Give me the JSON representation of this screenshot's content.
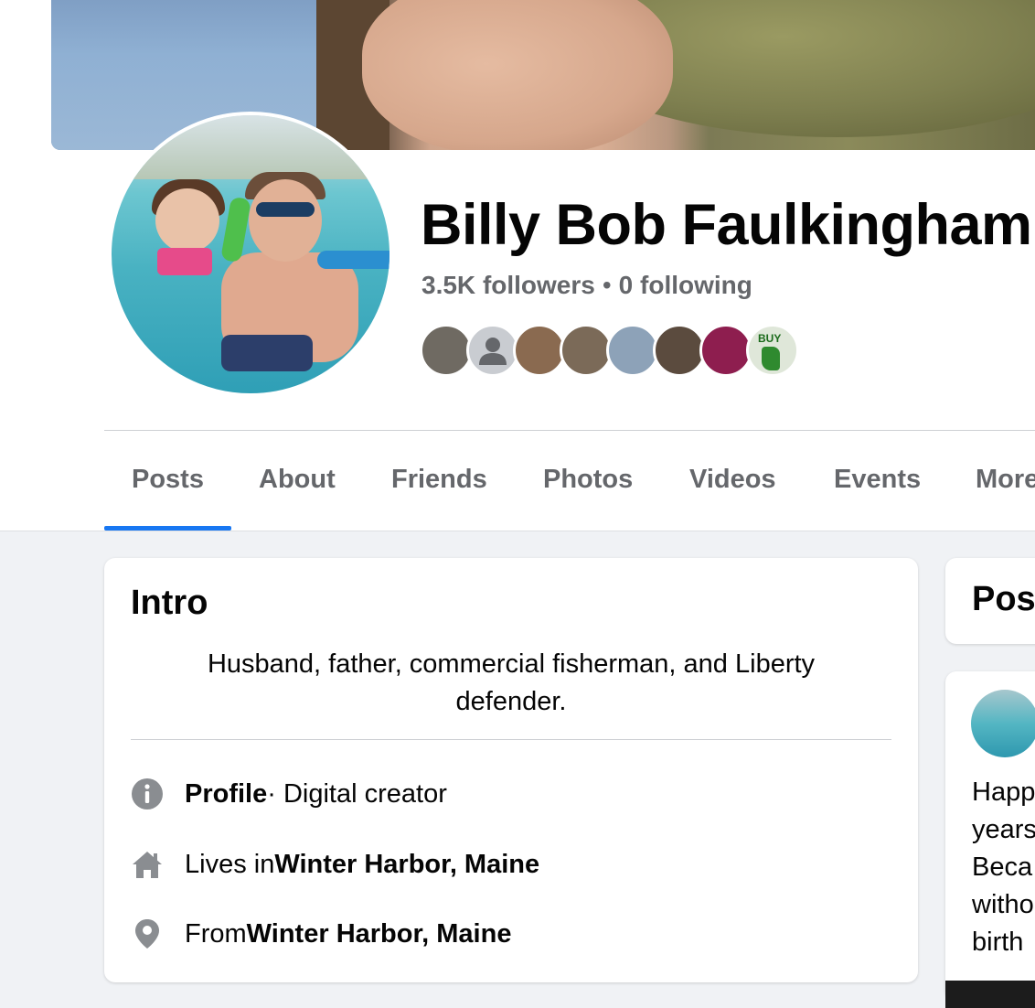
{
  "profile": {
    "name": "Billy Bob Faulkingham",
    "followers_count": "3.5K",
    "followers_label": "followers",
    "separator": "•",
    "following_count": "0",
    "following_label": "following"
  },
  "friends_preview": [
    {
      "name": "friend-1",
      "color": "#6f6a62"
    },
    {
      "name": "friend-2",
      "color": "#c9ccd1"
    },
    {
      "name": "friend-3",
      "color": "#8a6a50"
    },
    {
      "name": "friend-4",
      "color": "#7b6a58"
    },
    {
      "name": "friend-5",
      "color": "#8da2b8"
    },
    {
      "name": "friend-6",
      "color": "#5b4b3e"
    },
    {
      "name": "friend-7",
      "color": "#8e1e4f"
    },
    {
      "name": "friend-8",
      "color": "#dfe7d9"
    }
  ],
  "friend_badge_text": "BUY",
  "tabs": [
    {
      "label": "Posts",
      "active": true
    },
    {
      "label": "About",
      "active": false
    },
    {
      "label": "Friends",
      "active": false
    },
    {
      "label": "Photos",
      "active": false
    },
    {
      "label": "Videos",
      "active": false
    },
    {
      "label": "Events",
      "active": false
    },
    {
      "label": "More",
      "active": false
    }
  ],
  "intro": {
    "title": "Intro",
    "bio": "Husband, father, commercial fisherman, and Liberty defender.",
    "details": [
      {
        "icon": "info-icon",
        "bold_prefix": "Profile",
        "text": " · Digital creator",
        "bold_suffix": ""
      },
      {
        "icon": "home-icon",
        "bold_prefix": "",
        "text": "Lives in ",
        "bold_suffix": "Winter Harbor, Maine"
      },
      {
        "icon": "location-pin-icon",
        "bold_prefix": "",
        "text": "From ",
        "bold_suffix": "Winter Harbor, Maine"
      }
    ]
  },
  "posts_section": {
    "title": "Pos",
    "post_preview_lines": [
      "Happ",
      "years",
      "Beca",
      "witho",
      "birth"
    ]
  },
  "colors": {
    "accent": "#1877f2",
    "secondary_text": "#65676b",
    "page_bg": "#f0f2f5"
  }
}
